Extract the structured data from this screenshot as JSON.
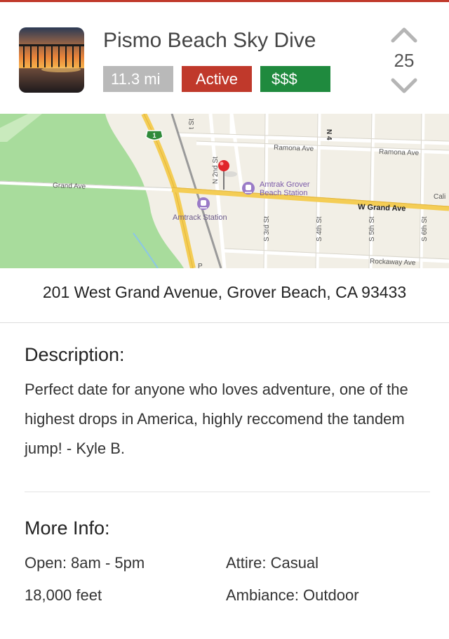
{
  "listing": {
    "title": "Pismo Beach Sky Dive",
    "distance": "11.3 mi",
    "status": "Active",
    "price": "$$$",
    "votes": "25"
  },
  "map": {
    "streets": {
      "ramona_ave_1": "Ramona Ave",
      "ramona_ave_2": "Ramona Ave",
      "grand_ave": "Grand Ave",
      "w_grand_ave": "W Grand Ave",
      "rockaway_ave": "Rockaway Ave",
      "n2nd": "N 2nd St",
      "s3rd": "S 3rd St",
      "s4th": "S 4th St",
      "s5th": "S 5th St",
      "s6th": "S 6th St",
      "n4": "N 4",
      "st_partial": "t St",
      "cali_partial": "Cali",
      "p_partial": "P"
    },
    "highway_shield": "1",
    "poi": {
      "amtrak_grover_line1": "Amtrak Grover",
      "amtrak_grover_line2": "Beach Station",
      "amtrak_station": "Amtrack Station"
    }
  },
  "address": "201 West Grand Avenue, Grover Beach, CA 93433",
  "description": {
    "heading": "Description:",
    "text": "Perfect date for anyone who loves adventure, one of the highest drops in America, highly reccomend the tandem jump!  - Kyle B."
  },
  "more_info": {
    "heading": "More Info:",
    "open": "Open: 8am - 5pm",
    "attire": "Attire: Casual",
    "height": "18,000 feet",
    "ambiance": "Ambiance: Outdoor"
  },
  "colors": {
    "accent_red": "#c0392b",
    "price_green": "#1f8a3e",
    "distance_gray": "#b9b9b9",
    "park_green": "#a8dc9c",
    "map_land": "#f2efe6",
    "road_yellow": "#f4cd55"
  },
  "icons": {
    "vote_up": "chevron-up-icon",
    "vote_down": "chevron-down-icon",
    "map_pin": "map-pin-icon",
    "train": "train-station-icon",
    "highway": "highway-shield-icon"
  }
}
